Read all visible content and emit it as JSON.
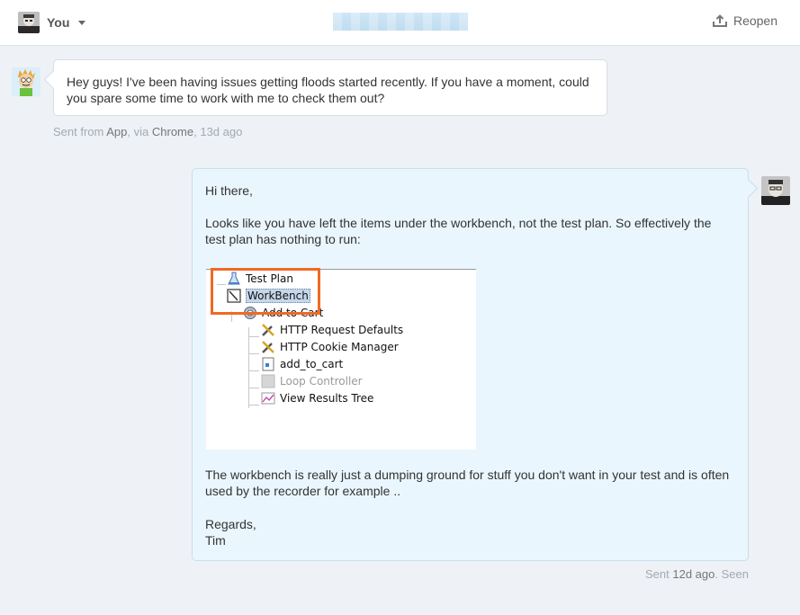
{
  "header": {
    "user_name": "You",
    "reopen_label": "Reopen"
  },
  "message_in": {
    "text": "Hey guys! I've been having issues getting floods started recently. If you have a moment, could you spare some time to work with me to check them out?",
    "meta": {
      "prefix": "Sent from",
      "app": "App",
      "via": ", via",
      "browser": "Chrome",
      "time": ", 13d ago"
    }
  },
  "message_out": {
    "greeting": "Hi there,",
    "para1": "Looks like you have left the items under the workbench, not the test plan. So effectively the test plan has nothing to run:",
    "para2": "The workbench is really just a dumping ground for stuff you don't want in your test and is often used by the recorder for example ..",
    "sign_regards": "Regards,",
    "sign_name": "Tim",
    "meta": {
      "prefix": "Sent",
      "time": "12d ago",
      "seen": ". Seen"
    },
    "screenshot_tree": [
      {
        "label": "Test Plan",
        "icon": "flask-icon"
      },
      {
        "label": "WorkBench",
        "icon": "workbench-icon"
      },
      {
        "label": "Add to Cart",
        "icon": "gear-icon"
      },
      {
        "label": "HTTP Request Defaults",
        "icon": "wrench-icon"
      },
      {
        "label": "HTTP Cookie Manager",
        "icon": "wrench-icon"
      },
      {
        "label": "add_to_cart",
        "icon": "sampler-icon"
      },
      {
        "label": "Loop Controller",
        "icon": "controller-icon"
      },
      {
        "label": "View Results Tree",
        "icon": "chart-icon"
      }
    ]
  },
  "colors": {
    "accent_highlight": "#f06a23",
    "out_bubble": "#eaf6fd",
    "background": "#eef1f5"
  }
}
